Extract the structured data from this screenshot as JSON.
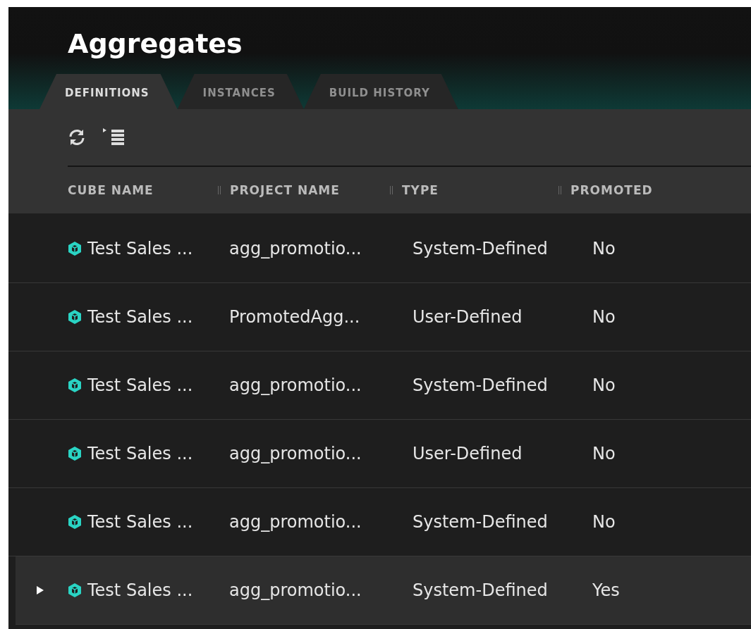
{
  "title": "Aggregates",
  "tabs": [
    {
      "label": "DEFINITIONS",
      "selected": true
    },
    {
      "label": "INSTANCES",
      "selected": false
    },
    {
      "label": "BUILD HISTORY",
      "selected": false
    }
  ],
  "table": {
    "columns": [
      "CUBE NAME",
      "PROJECT NAME",
      "TYPE",
      "PROMOTED"
    ],
    "rows": [
      {
        "cells": [
          "Test Sales ...",
          "agg_promotio...",
          "System-Defined",
          "No"
        ],
        "selected": false
      },
      {
        "cells": [
          "Test Sales ...",
          "PromotedAgg...",
          "User-Defined",
          "No"
        ],
        "selected": false
      },
      {
        "cells": [
          "Test Sales ...",
          "agg_promotio...",
          "System-Defined",
          "No"
        ],
        "selected": false
      },
      {
        "cells": [
          "Test Sales ...",
          "agg_promotio...",
          "User-Defined",
          "No"
        ],
        "selected": false
      },
      {
        "cells": [
          "Test Sales ...",
          "agg_promotio...",
          "System-Defined",
          "No"
        ],
        "selected": false
      },
      {
        "cells": [
          "Test Sales ...",
          "agg_promotio...",
          "System-Defined",
          "Yes"
        ],
        "selected": true
      }
    ]
  }
}
